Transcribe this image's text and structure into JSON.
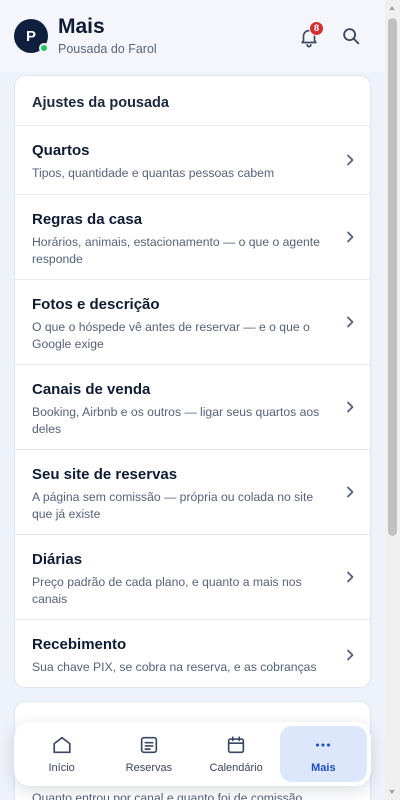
{
  "header": {
    "avatar_initial": "P",
    "title": "Mais",
    "subtitle": "Pousada do Farol",
    "notification_count": "8"
  },
  "settings_card": {
    "title": "Ajustes da pousada",
    "items": [
      {
        "title": "Quartos",
        "description": "Tipos, quantidade e quantas pessoas cabem"
      },
      {
        "title": "Regras da casa",
        "description": "Horários, animais, estacionamento — o que o agente responde"
      },
      {
        "title": "Fotos e descrição",
        "description": "O que o hóspede vê antes de reservar — e o que o Google exige"
      },
      {
        "title": "Canais de venda",
        "description": "Booking, Airbnb e os outros — ligar seus quartos aos deles"
      },
      {
        "title": "Seu site de reservas",
        "description": "A página sem comissão — própria ou colada no site que já existe"
      },
      {
        "title": "Diárias",
        "description": "Preço padrão de cada plano, e quanto a mais nos canais"
      },
      {
        "title": "Recebimento",
        "description": "Sua chave PIX, se cobra na reserva, e as cobranças"
      }
    ]
  },
  "second_card": {
    "partial_text": "Quanto entrou por canal e quanto foi de comissão"
  },
  "tabbar": {
    "tabs": [
      {
        "label": "Início",
        "icon": "home-icon"
      },
      {
        "label": "Reservas",
        "icon": "list-icon"
      },
      {
        "label": "Calendário",
        "icon": "calendar-icon"
      },
      {
        "label": "Mais",
        "icon": "more-icon"
      }
    ],
    "active_tab": "Mais"
  },
  "colors": {
    "accent": "#1f4fbf",
    "avatar_bg": "#0f1f3d",
    "badge": "#d32f2f",
    "online": "#22c55e"
  }
}
